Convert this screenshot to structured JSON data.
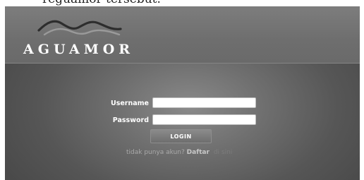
{
  "caption": {
    "text": "reguamor tersebut."
  },
  "brand": {
    "name": "AGUAMOR",
    "logo_icon": "mountain-ridges-logo",
    "colors": {
      "header_bg": "#6e6e6e",
      "panel_bg": "#5a5a5a",
      "logo_ridge_dark": "#2d2d2d",
      "logo_ridge_light": "#9a9a9a"
    }
  },
  "login_form": {
    "username_label": "Username",
    "username_value": "",
    "password_label": "Password",
    "password_value": "",
    "submit_label": "LOGIN"
  },
  "signup": {
    "question": "tidak punya akun?",
    "link_label": "Daftar",
    "trailing": "di sini"
  }
}
